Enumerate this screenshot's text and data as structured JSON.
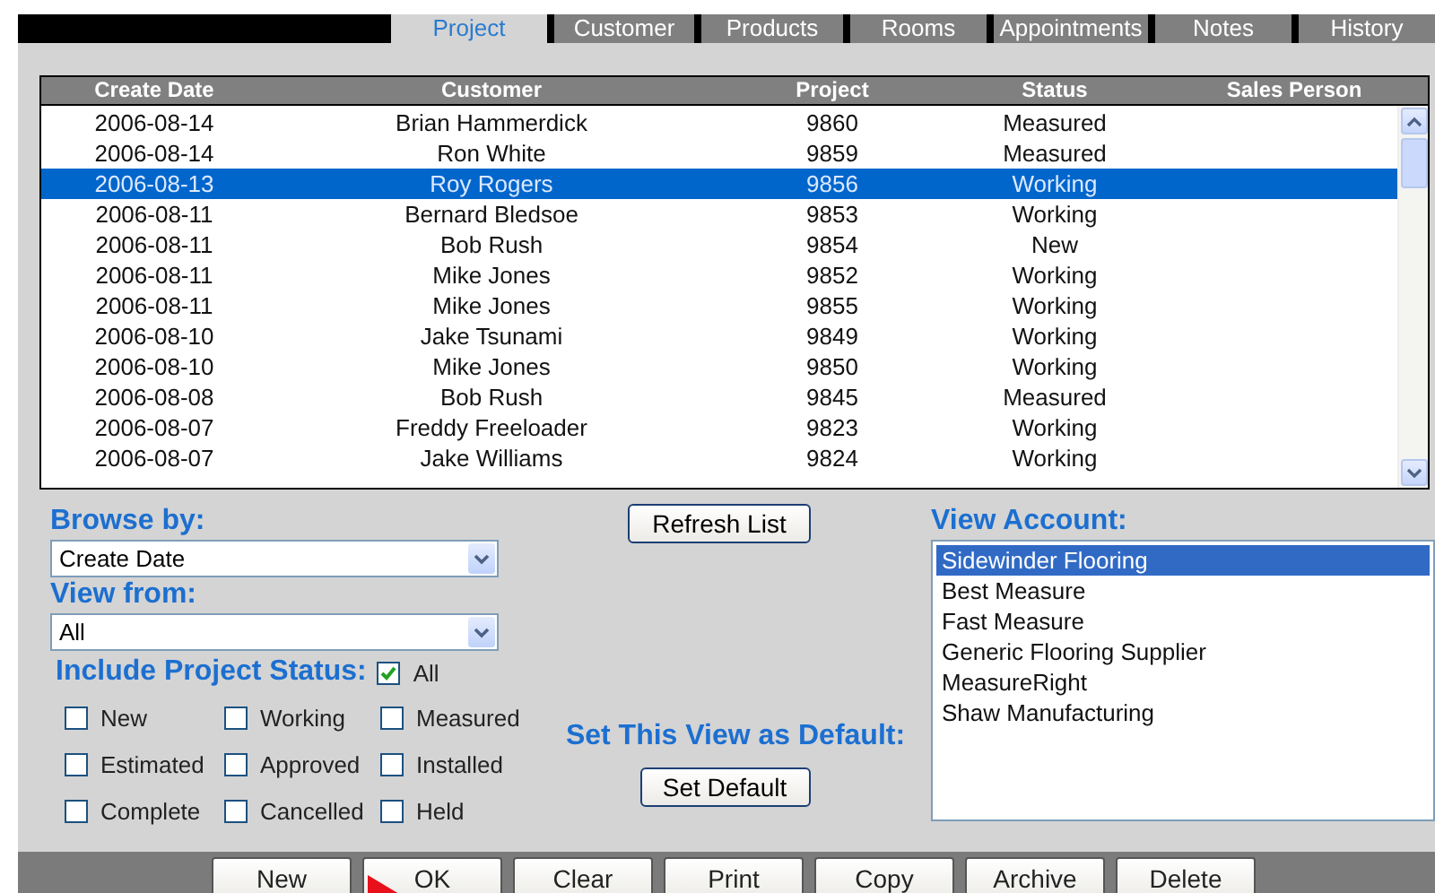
{
  "tabs": [
    {
      "label": "Project",
      "selected": true
    },
    {
      "label": "Customer",
      "selected": false
    },
    {
      "label": "Products",
      "selected": false
    },
    {
      "label": "Rooms",
      "selected": false
    },
    {
      "label": "Appointments",
      "selected": false
    },
    {
      "label": "Notes",
      "selected": false
    },
    {
      "label": "History",
      "selected": false
    }
  ],
  "table": {
    "columns": [
      "Create Date",
      "Customer",
      "Project",
      "Status",
      "Sales Person"
    ],
    "rows": [
      {
        "cells": [
          "2006-08-14",
          "Brian Hammerdick",
          "9860",
          "Measured"
        ],
        "selected": false
      },
      {
        "cells": [
          "2006-08-14",
          "Ron White",
          "9859",
          "Measured"
        ],
        "selected": false
      },
      {
        "cells": [
          "2006-08-13",
          "Roy Rogers",
          "9856",
          "Working"
        ],
        "selected": true
      },
      {
        "cells": [
          "2006-08-11",
          "Bernard Bledsoe",
          "9853",
          "Working"
        ],
        "selected": false
      },
      {
        "cells": [
          "2006-08-11",
          "Bob Rush",
          "9854",
          "New"
        ],
        "selected": false
      },
      {
        "cells": [
          "2006-08-11",
          "Mike Jones",
          "9852",
          "Working"
        ],
        "selected": false
      },
      {
        "cells": [
          "2006-08-11",
          "Mike Jones",
          "9855",
          "Working"
        ],
        "selected": false
      },
      {
        "cells": [
          "2006-08-10",
          "Jake Tsunami",
          "9849",
          "Working"
        ],
        "selected": false
      },
      {
        "cells": [
          "2006-08-10",
          "Mike Jones",
          "9850",
          "Working"
        ],
        "selected": false
      },
      {
        "cells": [
          "2006-08-08",
          "Bob Rush",
          "9845",
          "Measured"
        ],
        "selected": false
      },
      {
        "cells": [
          "2006-08-07",
          "Freddy Freeloader",
          "9823",
          "Working"
        ],
        "selected": false
      },
      {
        "cells": [
          "2006-08-07",
          "Jake Williams",
          "9824",
          "Working"
        ],
        "selected": false
      }
    ]
  },
  "browse_by": {
    "label": "Browse by:",
    "value": "Create Date"
  },
  "view_from": {
    "label": "View from:",
    "value": "All"
  },
  "status_filter": {
    "label": "Include Project Status:",
    "all": {
      "label": "All",
      "checked": true
    },
    "options": [
      {
        "label": "New",
        "checked": false
      },
      {
        "label": "Working",
        "checked": false
      },
      {
        "label": "Measured",
        "checked": false
      },
      {
        "label": "Estimated",
        "checked": false
      },
      {
        "label": "Approved",
        "checked": false
      },
      {
        "label": "Installed",
        "checked": false
      },
      {
        "label": "Complete",
        "checked": false
      },
      {
        "label": "Cancelled",
        "checked": false
      },
      {
        "label": "Held",
        "checked": false
      }
    ]
  },
  "refresh_button": "Refresh List",
  "default_view": {
    "label": "Set This View as Default:",
    "button": "Set Default"
  },
  "view_account": {
    "label": "View Account:",
    "items": [
      {
        "label": "Sidewinder Flooring",
        "selected": true
      },
      {
        "label": "Best Measure",
        "selected": false
      },
      {
        "label": "Fast Measure",
        "selected": false
      },
      {
        "label": "Generic Flooring Supplier",
        "selected": false
      },
      {
        "label": "MeasureRight",
        "selected": false
      },
      {
        "label": "Shaw Manufacturing",
        "selected": false
      }
    ]
  },
  "buttons": [
    "New",
    "OK",
    "Clear",
    "Print",
    "Copy",
    "Archive",
    "Delete"
  ]
}
